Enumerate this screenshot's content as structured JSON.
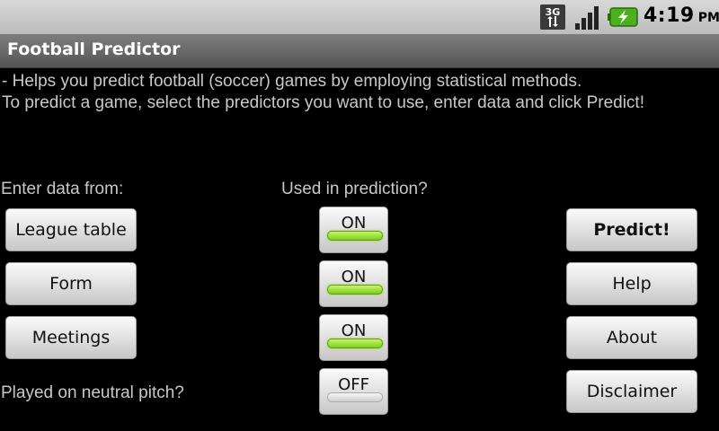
{
  "status_bar": {
    "network_icon": "3g-data-icon",
    "signal_icon": "signal-strength-icon",
    "battery_icon": "battery-charging-icon",
    "battery_color": "#4caf1e",
    "time": "4:19",
    "ampm": "PM"
  },
  "app": {
    "title": "Football Predictor"
  },
  "description": {
    "line1": "- Helps you predict football (soccer) games by employing statistical methods.",
    "line2": " To predict a game, select the predictors you want to use, enter data and click Predict!"
  },
  "labels": {
    "enter_data_from": "Enter data from:",
    "used_in_prediction": "Used in prediction?",
    "neutral_pitch": "Played on neutral pitch?"
  },
  "data_buttons": {
    "league_table": "League table",
    "form": "Form",
    "meetings": "Meetings"
  },
  "toggles": [
    {
      "label": "ON",
      "state": "on"
    },
    {
      "label": "ON",
      "state": "on"
    },
    {
      "label": "ON",
      "state": "on"
    },
    {
      "label": "OFF",
      "state": "off"
    }
  ],
  "action_buttons": {
    "predict": "Predict!",
    "help": "Help",
    "about": "About",
    "disclaimer": "Disclaimer"
  },
  "colors": {
    "toggle_on": "#7ccf1e",
    "toggle_off": "#d0d0d0",
    "title_bar": "#666666",
    "status_bar": "#cccccc"
  }
}
